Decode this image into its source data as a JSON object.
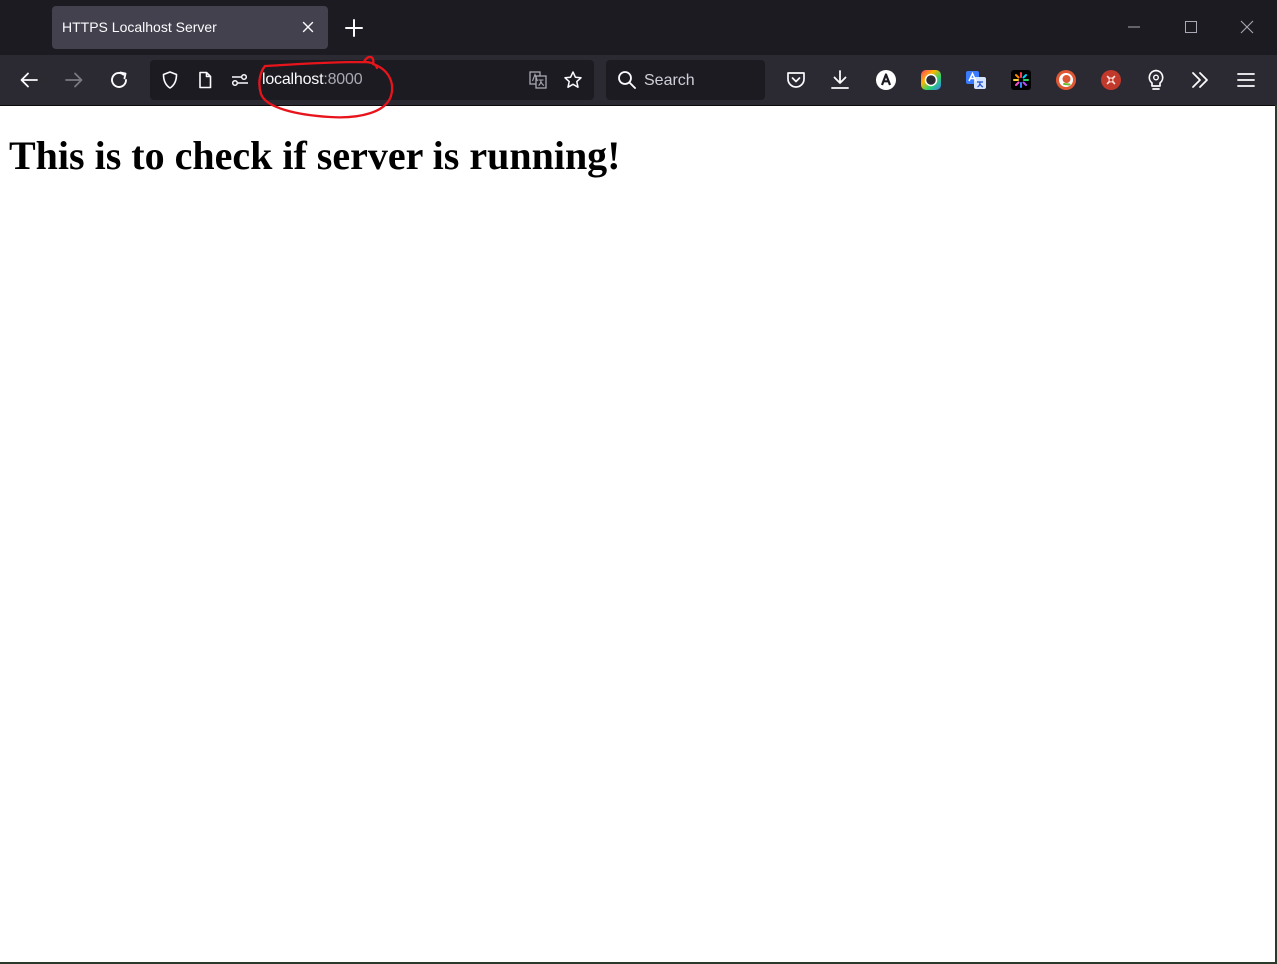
{
  "browser": {
    "tab": {
      "title": "HTTPS Localhost Server"
    },
    "urlbar": {
      "host": "localhost",
      "port": ":8000"
    },
    "search": {
      "placeholder": "Search"
    }
  },
  "page": {
    "heading": "This is to check if server is running!"
  },
  "icons": {
    "tab_close": "close-icon",
    "new_tab": "plus-icon",
    "back": "arrow-left-icon",
    "forward": "arrow-right-icon",
    "reload": "reload-icon",
    "tracking_protection": "shield-icon",
    "page_info": "page-icon",
    "permissions": "permissions-icon",
    "translate": "translate-icon",
    "bookmark": "star-icon",
    "pocket": "pocket-icon",
    "downloads": "download-icon",
    "overflow": "chevron-double-right-icon",
    "menu": "hamburger-icon"
  },
  "colors": {
    "tabstrip": "#1c1b22",
    "toolbar": "#2b2a33",
    "tab_selected": "#42414d",
    "annotation": "#e8141c"
  }
}
